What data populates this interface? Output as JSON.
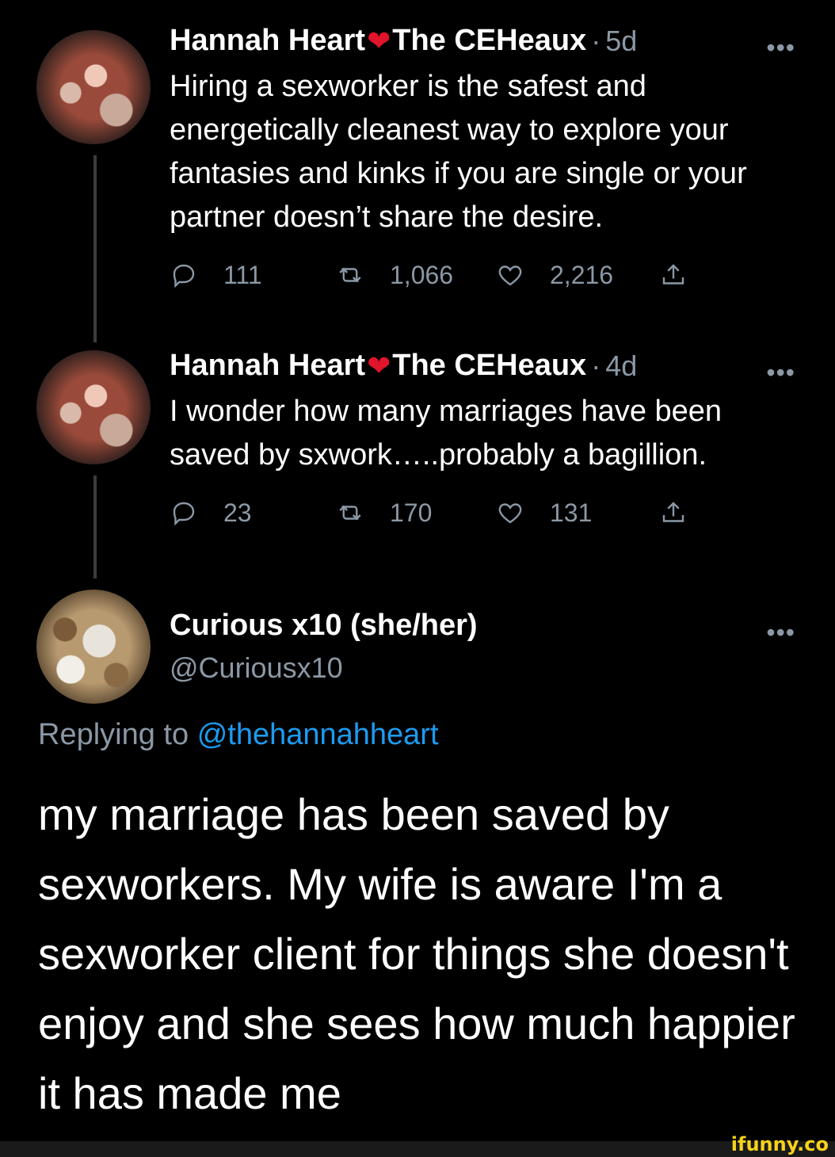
{
  "tweet1": {
    "author": "Hannah Heart",
    "heart_glyph": "❤",
    "author_suffix": "The CEHeaux",
    "separator": "·",
    "age": "5d",
    "more_glyph": "•••",
    "text": "Hiring a sexworker is the safest and energetically cleanest way to explore your fantasies and kinks if you are single or your partner doesn’t share the desire.",
    "replies": "111",
    "retweets": "1,066",
    "likes": "2,216"
  },
  "tweet2": {
    "author": "Hannah Heart",
    "heart_glyph": "❤",
    "author_suffix": "The CEHeaux",
    "separator": "·",
    "age": "4d",
    "more_glyph": "•••",
    "text": "I wonder how many marriages have been saved by sxwork…..probably a bagillion.",
    "replies": "23",
    "retweets": "170",
    "likes": "131"
  },
  "reply": {
    "author": "Curious x10 (she/her)",
    "handle": "@Curiousx10",
    "more_glyph": "•••",
    "replying_prefix": "Replying to",
    "replying_to": "@thehannahheart",
    "text": "my marriage has been saved by sexworkers.  My wife is aware I'm a sexworker client for things she doesn't enjoy and she sees how much happier it has made me"
  },
  "watermark": "ifunny.co",
  "colors": {
    "background": "#000000",
    "muted": "#8b98a5",
    "link": "#1d9bf0",
    "heart": "#e0142b",
    "watermark": "#f7d21a"
  },
  "icons": [
    "reply-icon",
    "retweet-icon",
    "like-icon",
    "share-icon",
    "more-icon"
  ]
}
